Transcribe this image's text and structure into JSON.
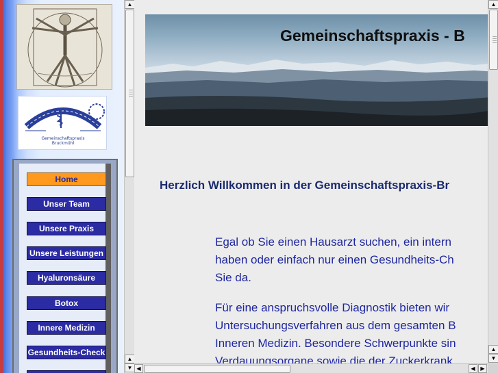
{
  "logo": {
    "line1": "Gemeinschaftspraxis",
    "line2": "Bruckmühl"
  },
  "menu": {
    "items": [
      {
        "label": "Home",
        "active": true
      },
      {
        "label": "Unser Team"
      },
      {
        "label": "Unsere Praxis"
      },
      {
        "label": "Unsere Leistungen"
      },
      {
        "label": "Hyaluronsäure"
      },
      {
        "label": "Botox"
      },
      {
        "label": "Innere Medizin"
      },
      {
        "label": "Gesundheits-Check"
      }
    ]
  },
  "banner": {
    "title": "Gemeinschaftspraxis - B"
  },
  "content": {
    "welcome": "Herzlich Willkommen in der Gemeinschaftspraxis-Br",
    "paragraph1": [
      "Egal ob Sie einen Hausarzt suchen, ein intern",
      "haben oder einfach nur einen Gesundheits-Ch",
      "Sie da."
    ],
    "paragraph2": [
      "Für eine anspruchsvolle Diagnostik bieten wir",
      "Untersuchungsverfahren aus dem gesamten B",
      "Inneren Medizin. Besondere Schwerpunkte sin",
      "Verdauungsorgane sowie die der Zuckerkrank"
    ]
  },
  "colors": {
    "menu_button": "#2b2ba4",
    "menu_button_active": "#ff9a1f",
    "body_text": "#1e26a0",
    "welcome_text": "#1a2a6e"
  },
  "icons": {
    "scroll_up": "arrow-up-icon",
    "scroll_down": "arrow-down-icon",
    "scroll_left": "arrow-left-icon",
    "scroll_right": "arrow-right-icon"
  }
}
